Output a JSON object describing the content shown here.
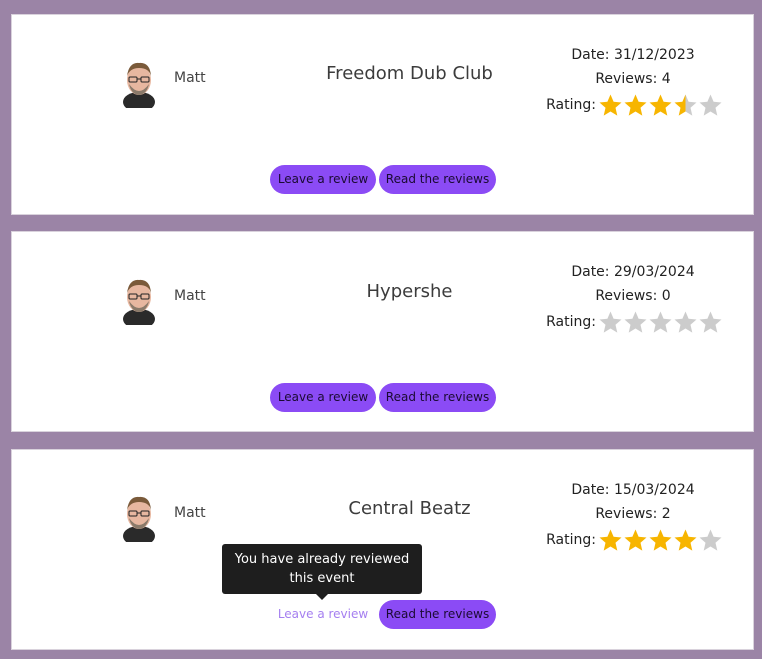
{
  "colors": {
    "accent": "#8b4bf5",
    "star_on": "#f7b500",
    "star_off": "#cccccc",
    "background": "#9b84a6"
  },
  "events": [
    {
      "user": "Matt",
      "title": "Freedom Dub Club",
      "date": "Date: 31/12/2023",
      "reviews": "Reviews: 4",
      "rating_label": "Rating:",
      "rating": 3.5,
      "leave_label": "Leave a review",
      "read_label": "Read the reviews"
    },
    {
      "user": "Matt",
      "title": "Hypershe",
      "date": "Date: 29/03/2024",
      "reviews": "Reviews: 0",
      "rating_label": "Rating:",
      "rating": 0,
      "leave_label": "Leave a review",
      "read_label": "Read the reviews"
    },
    {
      "user": "Matt",
      "title": "Central Beatz",
      "date": "Date: 15/03/2024",
      "reviews": "Reviews: 2",
      "rating_label": "Rating:",
      "rating": 4,
      "leave_label": "Leave a review",
      "read_label": "Read the reviews"
    }
  ],
  "tooltip": {
    "text": "You have already reviewed this event"
  }
}
